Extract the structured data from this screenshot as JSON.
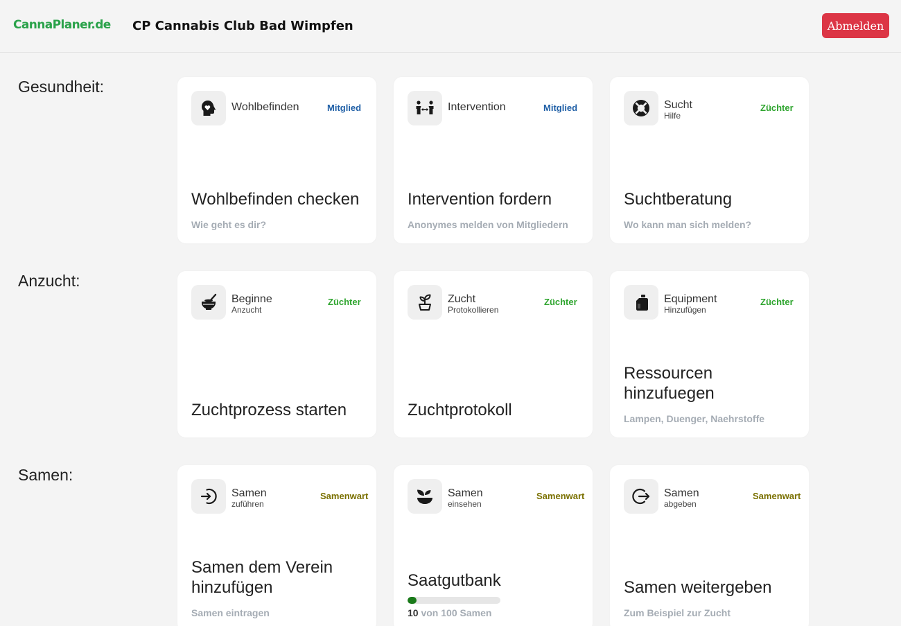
{
  "header": {
    "logo": "CannaPlaner.de",
    "club_name": "CP Cannabis Club Bad Wimpfen",
    "logout_label": "Abmelden"
  },
  "colors": {
    "logo_green": "#2aa24a",
    "logout_red": "#dc3545",
    "role_mitglied": "#1f5fa6",
    "role_zuechter": "#2fa52f",
    "role_samenwart": "#7a7000",
    "progress_fill": "#1a7a1a"
  },
  "sections": [
    {
      "label": "Gesundheit:",
      "cards": [
        {
          "name": "Wohlbefinden",
          "sub": "",
          "role": "Mitglied",
          "title": "Wohlbefinden checken",
          "desc": "Wie geht es dir?",
          "icon": "head-heart-icon"
        },
        {
          "name": "Intervention",
          "sub": "",
          "role": "Mitglied",
          "title": "Intervention fordern",
          "desc": "Anonymes melden von Mitgliedern",
          "icon": "people-arrows-icon"
        },
        {
          "name": "Sucht",
          "sub": "Hilfe",
          "role": "Züchter",
          "title": "Suchtberatung",
          "desc": "Wo kann man sich melden?",
          "icon": "life-ring-icon"
        }
      ]
    },
    {
      "label": "Anzucht:",
      "cards": [
        {
          "name": "Beginne",
          "sub": "Anzucht",
          "role": "Züchter",
          "title": "Zuchtprozess starten",
          "desc": "",
          "icon": "mortar-pestle-icon"
        },
        {
          "name": "Zucht",
          "sub": "Protokollieren",
          "role": "Züchter",
          "title": "Zuchtprotokoll",
          "desc": "",
          "icon": "sprout-pot-icon"
        },
        {
          "name": "Equipment",
          "sub": "Hinzufügen",
          "role": "Züchter",
          "title": "Ressourcen hinzufuegen",
          "desc": "Lampen, Duenger, Naehrstoffe",
          "icon": "jug-icon"
        }
      ]
    },
    {
      "label": "Samen:",
      "cards": [
        {
          "name": "Samen",
          "sub": "zuführen",
          "role": "Samenwart",
          "title": "Samen dem Verein hinzufügen",
          "desc": "Samen eintragen",
          "icon": "sign-in-icon"
        },
        {
          "name": "Samen",
          "sub": "einsehen",
          "role": "Samenwart",
          "title": "Saatgutbank",
          "desc": "",
          "icon": "seedling-bowl-icon"
        },
        {
          "name": "Samen",
          "sub": "abgeben",
          "role": "Samenwart",
          "title": "Samen weitergeben",
          "desc": "Zum Beispiel zur Zucht",
          "icon": "sign-out-icon"
        }
      ]
    }
  ],
  "seedbank": {
    "current": "10",
    "rest": " von 100 Samen",
    "fill_fraction": 0.1
  }
}
